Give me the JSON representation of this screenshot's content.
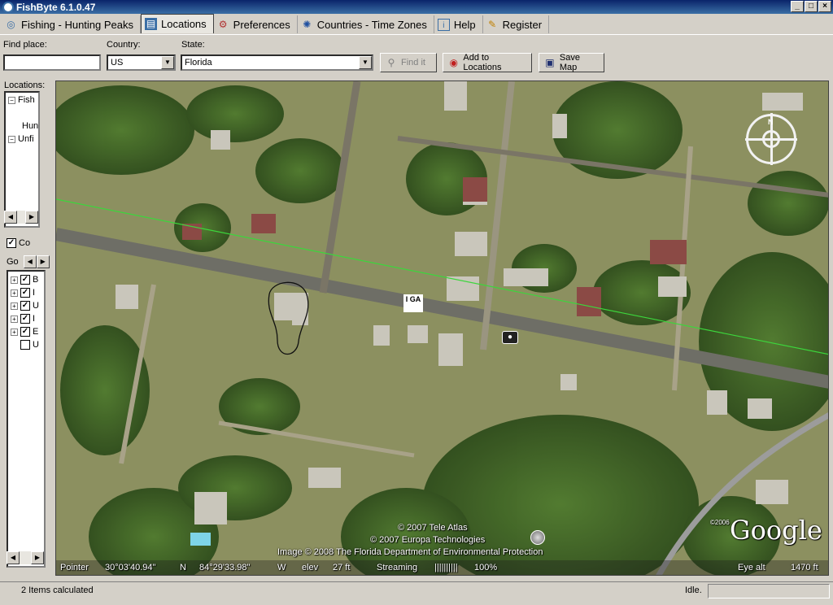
{
  "window": {
    "title": "FishByte 6.1.0.47"
  },
  "tabs": [
    {
      "label": "Fishing - Hunting Peaks",
      "icon": "compass-icon"
    },
    {
      "label": "Locations",
      "icon": "locations-icon"
    },
    {
      "label": "Preferences",
      "icon": "preferences-icon"
    },
    {
      "label": "Countries - Time Zones",
      "icon": "globe-icon"
    },
    {
      "label": "Help",
      "icon": "help-icon"
    },
    {
      "label": "Register",
      "icon": "register-icon"
    }
  ],
  "toolbar": {
    "find_place_label": "Find place:",
    "find_place_value": "",
    "country_label": "Country:",
    "country_value": "US",
    "state_label": "State:",
    "state_value": "Florida",
    "find_it_label": "Find it",
    "add_to_locations_label": "Add to Locations",
    "save_map_label": "Save Map"
  },
  "sidebar": {
    "locations_label": "Locations:",
    "tree_items": [
      "Fish",
      "Hun",
      "Unfi"
    ],
    "co_checkbox_label": "Co",
    "go_label": "Go",
    "layers": [
      {
        "label": "B",
        "checked": true
      },
      {
        "label": "I",
        "checked": true
      },
      {
        "label": "U",
        "checked": true
      },
      {
        "label": "I",
        "checked": true
      },
      {
        "label": "E",
        "checked": true
      },
      {
        "label": "U",
        "checked": false
      }
    ]
  },
  "map": {
    "label_iga": "I GA",
    "copyright_1": "© 2007 Tele Atlas",
    "copyright_2": "© 2007 Europa Technologies",
    "copyright_3": "Image © 2008 The Florida Department of Environmental Protection",
    "google_logo": "Google",
    "google_year": "©2006",
    "compass_n": "N",
    "pointer_label": "Pointer",
    "lat": "30°03'40.94\"",
    "lat_dir": "N",
    "lon": "84°29'33.98\"",
    "lon_dir": "W",
    "elev_label": "elev",
    "elev_value": "27 ft",
    "streaming_label": "Streaming",
    "streaming_bars": "||||||||||",
    "streaming_pct": "100%",
    "eye_alt_label": "Eye alt",
    "eye_alt_value": "1470 ft"
  },
  "status": {
    "items_calculated": "2  Items calculated",
    "state": "Idle.",
    "extra": ""
  },
  "colors": {
    "title_start": "#0a246a",
    "title_end": "#3a6ea5",
    "chrome": "#d4d0c8",
    "route_line": "#3cd63c"
  }
}
